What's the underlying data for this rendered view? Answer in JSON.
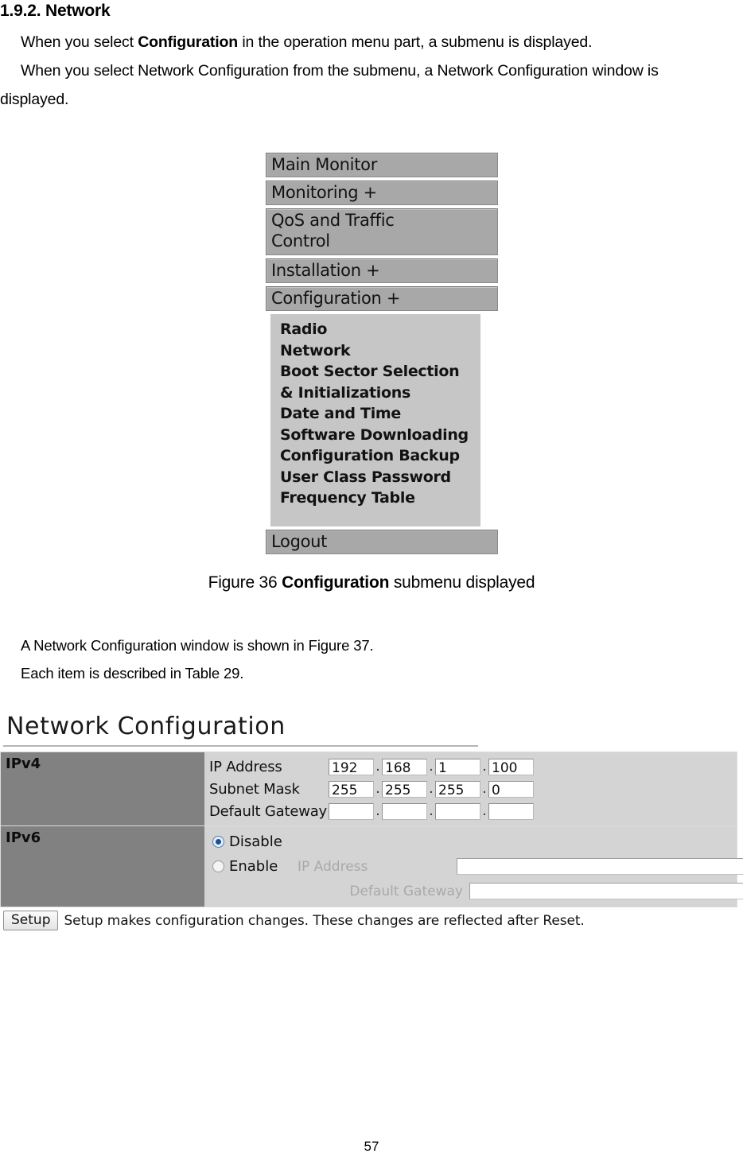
{
  "document": {
    "heading": "1.9.2. Network",
    "paragraph1_pre": "When you select ",
    "paragraph1_bold": "Configuration",
    "paragraph1_post": " in the operation menu part, a submenu is displayed.",
    "paragraph2": "When you select Network Configuration from the submenu, a Network Configuration window is",
    "paragraph3": "displayed.",
    "paragraph4": "A Network Configuration window is shown in Figure 37.",
    "paragraph5": "Each item is described in Table 29.",
    "page_number": "57"
  },
  "figure36": {
    "caption_pre": "Figure 36 ",
    "caption_bold": "Configuration",
    "caption_post": " submenu displayed",
    "menu_items": [
      {
        "label": "Main Monitor"
      },
      {
        "label": "Monitoring +"
      },
      {
        "label": "QoS and Traffic\nControl"
      },
      {
        "label": "Installation +"
      },
      {
        "label": "Configuration +"
      }
    ],
    "menu_item_0": "Main Monitor",
    "menu_item_1": "Monitoring +",
    "menu_item_2_line1": "QoS and Traffic",
    "menu_item_2_line2": "Control",
    "menu_item_3": "Installation +",
    "menu_item_4": "Configuration +",
    "submenu_items": [
      "Radio",
      "Network",
      "Boot Sector Selection",
      "& Initializations",
      "Date and Time",
      "Software Downloading",
      "Configuration Backup",
      "User Class Password",
      "Frequency Table"
    ],
    "logout_label": "Logout"
  },
  "figure37": {
    "window_title": "Network Configuration",
    "ipv4": {
      "section_label": "IPv4",
      "rows": [
        {
          "name": "IP Address",
          "octets": [
            "192",
            "168",
            "1",
            "100"
          ]
        },
        {
          "name": "Subnet Mask",
          "octets": [
            "255",
            "255",
            "255",
            "0"
          ]
        },
        {
          "name": "Default Gateway",
          "octets": [
            "",
            "",
            "",
            ""
          ]
        }
      ],
      "separator": "."
    },
    "ipv6": {
      "section_label": "IPv6",
      "disable_label": "Disable",
      "enable_label": "Enable",
      "selected": "Disable",
      "ip_address_label": "IP Address",
      "default_gateway_label": "Default Gateway",
      "ip_address_value": "",
      "default_gateway_value": ""
    },
    "setup": {
      "button_label": "Setup",
      "description": "Setup makes configuration changes. These changes are reflected after Reset."
    },
    "colors": {
      "section_header_bg": "#818181",
      "panel_bg": "#d4d4d4",
      "radio_selected": "#15539e",
      "menu_button_bg": "#a8a8a8",
      "submenu_bg": "#c6c6c6"
    }
  }
}
